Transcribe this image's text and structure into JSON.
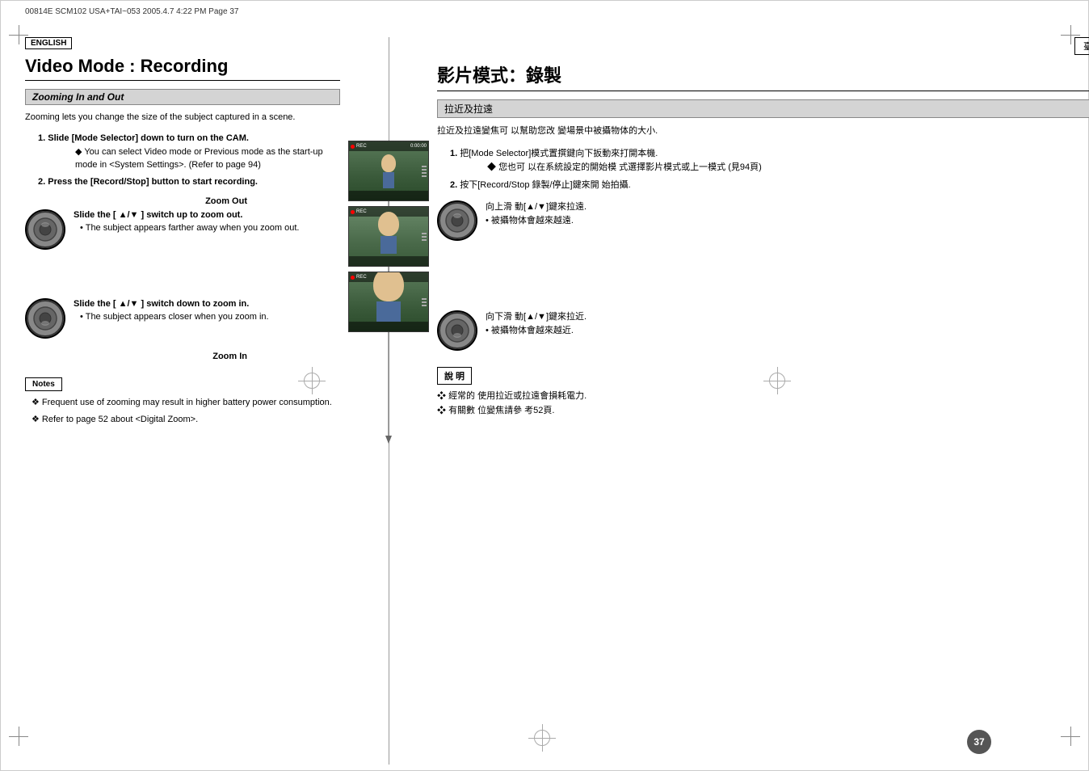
{
  "file_header": "00814E SCM102 USA+TAI~053 2005.4.7 4:22 PM Page 37",
  "left": {
    "lang_badge": "ENGLISH",
    "page_title": "Video Mode : Recording",
    "section_header": "Zooming In and Out",
    "section_desc": "Zooming lets you change the size of the subject captured in a scene.",
    "instructions": [
      {
        "num": "1.",
        "text": "Slide [Mode Selector] down to turn on the CAM.",
        "sub": [
          "You can select Video mode or Previous mode as the start-up mode in <System Settings>. (Refer to page 94)"
        ]
      },
      {
        "num": "2.",
        "text": "Press the [Record/Stop] button to start recording.",
        "sub": []
      }
    ],
    "zoom_out_label": "Zoom Out",
    "zoom_in_label": "Zoom In",
    "switch_up": {
      "label": "Slide the [ ▲/▼ ] switch up to zoom out.",
      "bullet": "The subject appears farther away when you zoom out."
    },
    "switch_down": {
      "label": "Slide the [ ▲/▼ ] switch down to zoom in.",
      "bullet": "The subject appears closer when you zoom in."
    },
    "notes_label": "Notes",
    "notes": [
      "Frequent use of zooming may result in higher battery power consumption.",
      "Refer to page 52 about <Digital Zoom>."
    ]
  },
  "right": {
    "taiwan_badge": "臺 灣",
    "page_title": "影片模式：錄製",
    "section_header": "拉近及拉遠",
    "section_desc": "拉近及拉遠變焦可 以幫助您改 變場景中被攝物体的大小.",
    "instructions": [
      {
        "num": "1.",
        "text": "把[Mode Selector]模式置撰鍵向下扳動來打開本機.",
        "sub": [
          "您也可 以在系統設定的開始模 式選擇影片模式或上一模式 (見94頁)"
        ]
      },
      {
        "num": "2.",
        "text": "按下[Record/Stop 錄製/停止]鍵來開 始拍攝.",
        "sub": []
      }
    ],
    "switch_up": {
      "label": "向上滑 動[▲/▼]鍵來拉遠.",
      "bullet": "被攝物体會越來越遠."
    },
    "switch_down": {
      "label": "向下滑 動[▲/▼]鍵來拉近.",
      "bullet": "被攝物体會越來越近."
    },
    "notes_label": "說 明",
    "notes": [
      "經常的 使用拉近或拉遠會損耗電力.",
      "有關數 位變焦請參 考52頁."
    ]
  },
  "page_number": "37",
  "previews": [
    {
      "status": "REC",
      "size": "small_child"
    },
    {
      "status": "REC",
      "size": "medium_child"
    },
    {
      "status": "REC",
      "size": "large_child"
    }
  ]
}
